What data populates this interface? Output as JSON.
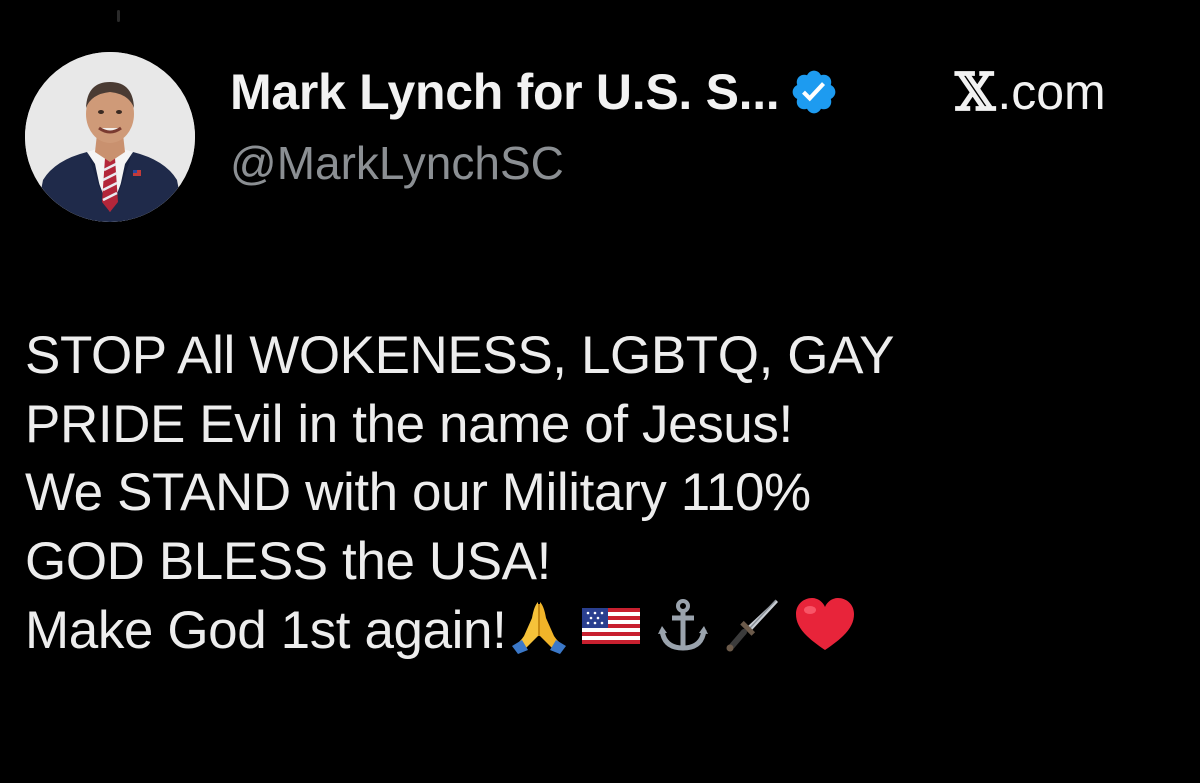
{
  "profile": {
    "display_name": "Mark Lynch for U.S. S...",
    "handle": "@MarkLynchSC",
    "verified_icon": "verified-badge-icon",
    "avatar_icon": "profile-photo-avatar"
  },
  "source": {
    "logo_text": "𝕏",
    "domain": ".com"
  },
  "tweet": {
    "lines": [
      "STOP All WOKENESS, LGBTQ, GAY",
      "PRIDE Evil in the name of Jesus!",
      "We STAND with our Military 110%",
      "GOD BLESS the USA!",
      "Make God 1st again!"
    ],
    "emojis": [
      "praying-hands-icon",
      "us-flag-icon",
      "anchor-icon",
      "dagger-icon",
      "red-heart-icon"
    ]
  },
  "colors": {
    "background": "#000000",
    "text": "#e7e9ea",
    "handle": "#8b8f93",
    "verified_blue": "#1d9bf0"
  }
}
